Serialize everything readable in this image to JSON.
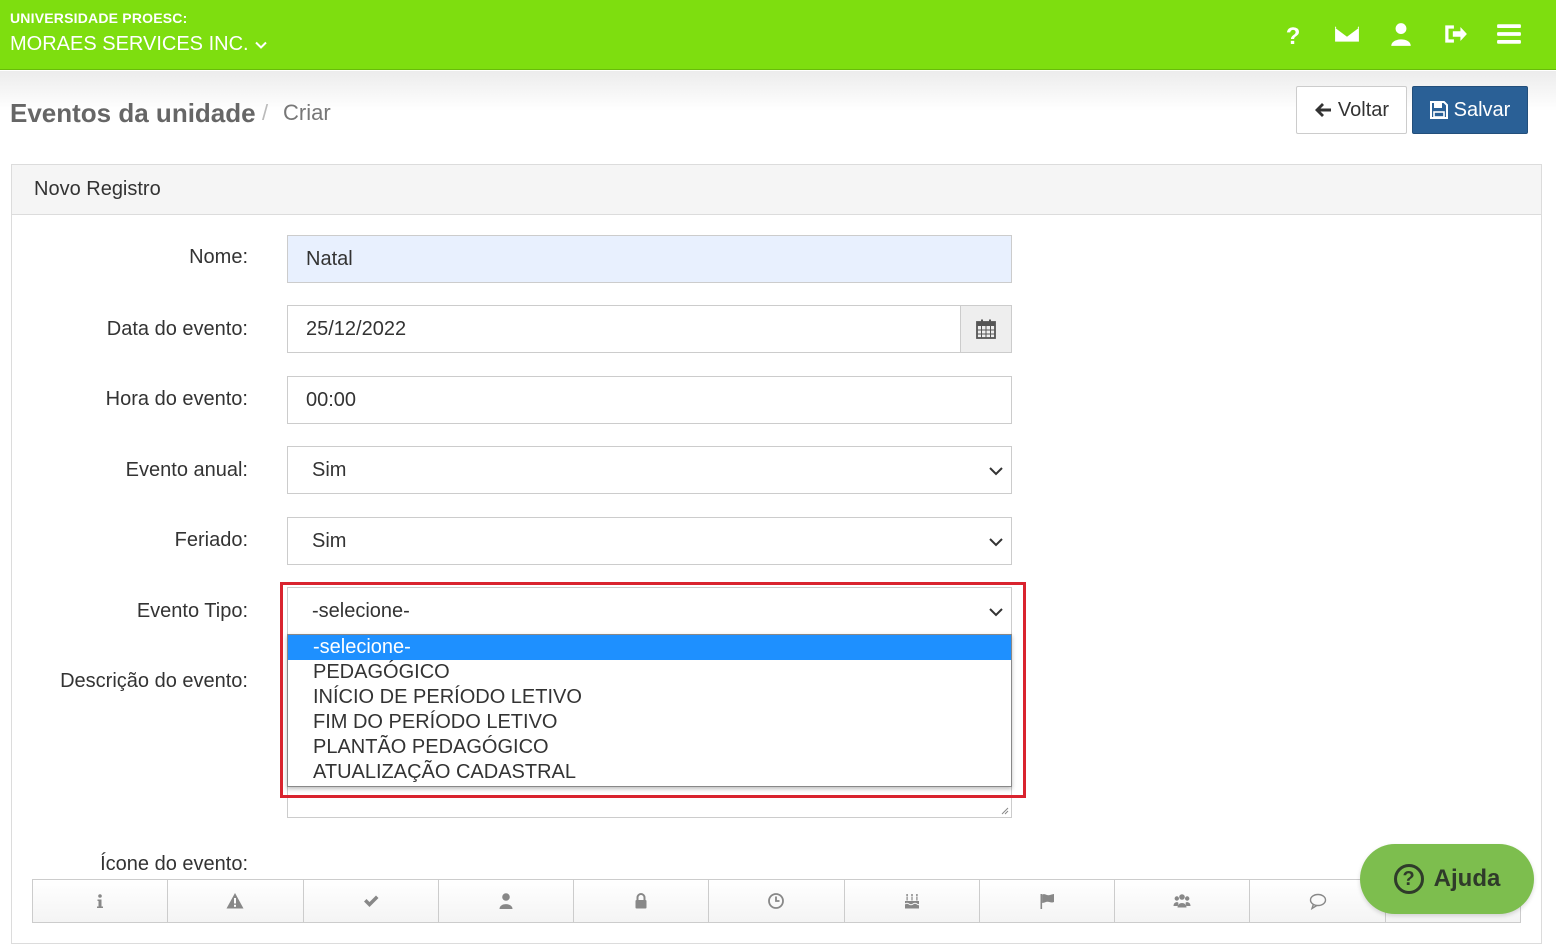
{
  "header": {
    "org_label": "UNIVERSIDADE PROESC:",
    "org_name": "MORAES SERVICES INC.",
    "icons": [
      "question-icon",
      "envelope-icon",
      "user-icon",
      "sign-out-icon",
      "menu-icon"
    ],
    "brand_color": "#7ede0f"
  },
  "breadcrumb": {
    "title": "Eventos da unidade",
    "separator": "/",
    "current": "Criar"
  },
  "actions": {
    "back_label": "Voltar",
    "save_label": "Salvar"
  },
  "panel": {
    "heading": "Novo Registro"
  },
  "form": {
    "nome": {
      "label": "Nome:",
      "value": "Natal"
    },
    "data": {
      "label": "Data do evento:",
      "value": "25/12/2022"
    },
    "hora": {
      "label": "Hora do evento:",
      "value": "00:00"
    },
    "anual": {
      "label": "Evento anual:",
      "value": "Sim"
    },
    "feriado": {
      "label": "Feriado:",
      "value": "Sim"
    },
    "tipo": {
      "label": "Evento Tipo:",
      "value": "-selecione-",
      "options": [
        "-selecione-",
        "PEDAGÓGICO",
        "INÍCIO DE PERÍODO LETIVO",
        "FIM DO PERÍODO LETIVO",
        "PLANTÃO PEDAGÓGICO",
        "ATUALIZAÇÃO CADASTRAL"
      ]
    },
    "descricao": {
      "label": "Descrição do evento:"
    },
    "icone": {
      "label": "Ícone do evento:",
      "icons": [
        "info-icon",
        "warning-icon",
        "check-icon",
        "user-icon",
        "lock-icon",
        "clock-icon",
        "birthday-cake-icon",
        "flag-icon",
        "group-icon",
        "comment-icon"
      ]
    }
  },
  "help": {
    "label": "Ajuda"
  }
}
